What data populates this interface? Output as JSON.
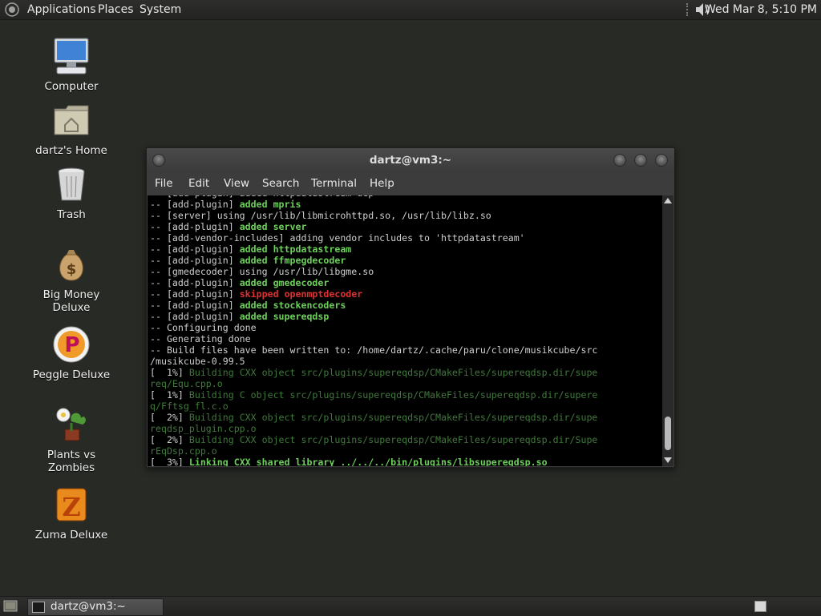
{
  "top_panel": {
    "menus": [
      "Applications",
      "Places",
      "System"
    ],
    "clock": "Wed Mar  8,  5:10 PM",
    "icons": [
      "gnome-foot-logo",
      "volume-icon"
    ]
  },
  "desktop_icons": [
    {
      "label": "Computer",
      "icon": "computer-icon"
    },
    {
      "label": "dartz's Home",
      "icon": "home-folder-icon"
    },
    {
      "label": "Trash",
      "icon": "trash-icon"
    },
    {
      "label": "Big Money Deluxe",
      "icon": "money-bag-icon"
    },
    {
      "label": "Peggle Deluxe",
      "icon": "peggle-icon"
    },
    {
      "label": "Plants vs Zombies",
      "icon": "plant-icon"
    },
    {
      "label": "Zuma Deluxe",
      "icon": "zuma-icon"
    }
  ],
  "terminal": {
    "title": "dartz@vm3:~",
    "menu": [
      "File",
      "Edit",
      "View",
      "Search",
      "Terminal",
      "Help"
    ],
    "lines": [
      [
        {
          "t": "-- [add-plugin] added httpdatastream dep",
          "c": "norm"
        }
      ],
      [
        {
          "t": "-- [add-plugin] ",
          "c": "norm"
        },
        {
          "t": "added mpris",
          "c": "green"
        }
      ],
      [
        {
          "t": "-- [server] using /usr/lib/libmicrohttpd.so, /usr/lib/libz.so",
          "c": "norm"
        }
      ],
      [
        {
          "t": "-- [add-plugin] ",
          "c": "norm"
        },
        {
          "t": "added server",
          "c": "green"
        }
      ],
      [
        {
          "t": "-- [add-vendor-includes] adding vendor includes to 'httpdatastream'",
          "c": "norm"
        }
      ],
      [
        {
          "t": "-- [add-plugin] ",
          "c": "norm"
        },
        {
          "t": "added httpdatastream",
          "c": "green"
        }
      ],
      [
        {
          "t": "-- [add-plugin] ",
          "c": "norm"
        },
        {
          "t": "added ffmpegdecoder",
          "c": "green"
        }
      ],
      [
        {
          "t": "-- [gmedecoder] using /usr/lib/libgme.so",
          "c": "norm"
        }
      ],
      [
        {
          "t": "-- [add-plugin] ",
          "c": "norm"
        },
        {
          "t": "added gmedecoder",
          "c": "green"
        }
      ],
      [
        {
          "t": "-- [add-plugin] ",
          "c": "norm"
        },
        {
          "t": "skipped openmptdecoder",
          "c": "red"
        }
      ],
      [
        {
          "t": "-- [add-plugin] ",
          "c": "norm"
        },
        {
          "t": "added stockencoders",
          "c": "green"
        }
      ],
      [
        {
          "t": "-- [add-plugin] ",
          "c": "norm"
        },
        {
          "t": "added supereqdsp",
          "c": "green"
        }
      ],
      [
        {
          "t": "-- Configuring done",
          "c": "norm"
        }
      ],
      [
        {
          "t": "-- Generating done",
          "c": "norm"
        }
      ],
      [
        {
          "t": "-- Build files have been written to: /home/dartz/.cache/paru/clone/musikcube/src",
          "c": "norm"
        }
      ],
      [
        {
          "t": "/musikcube-0.99.5",
          "c": "norm"
        }
      ],
      [
        {
          "t": "[  1%] ",
          "c": "norm"
        },
        {
          "t": "Building CXX object src/plugins/supereqdsp/CMakeFiles/supereqdsp.dir/supe",
          "c": "dim"
        }
      ],
      [
        {
          "t": "req/Equ.cpp.o",
          "c": "dim"
        }
      ],
      [
        {
          "t": "[  1%] ",
          "c": "norm"
        },
        {
          "t": "Building C object src/plugins/supereqdsp/CMakeFiles/supereqdsp.dir/supere",
          "c": "dim"
        }
      ],
      [
        {
          "t": "q/Fftsg_fl.c.o",
          "c": "dim"
        }
      ],
      [
        {
          "t": "[  2%] ",
          "c": "norm"
        },
        {
          "t": "Building CXX object src/plugins/supereqdsp/CMakeFiles/supereqdsp.dir/supe",
          "c": "dim"
        }
      ],
      [
        {
          "t": "reqdsp_plugin.cpp.o",
          "c": "dim"
        }
      ],
      [
        {
          "t": "[  2%] ",
          "c": "norm"
        },
        {
          "t": "Building CXX object src/plugins/supereqdsp/CMakeFiles/supereqdsp.dir/Supe",
          "c": "dim"
        }
      ],
      [
        {
          "t": "rEqDsp.cpp.o",
          "c": "dim"
        }
      ],
      [
        {
          "t": "[  3%] ",
          "c": "norm"
        },
        {
          "t": "Linking CXX shared library ../../../bin/plugins/libsupereqdsp.so",
          "c": "greenb"
        }
      ]
    ]
  },
  "taskbar": {
    "tasks": [
      {
        "label": "dartz@vm3:~"
      }
    ]
  },
  "colors": {
    "desktop_bg": "#282a26",
    "terminal_bg": "#000000",
    "success_green": "#6cd05a",
    "error_red": "#e03030"
  }
}
